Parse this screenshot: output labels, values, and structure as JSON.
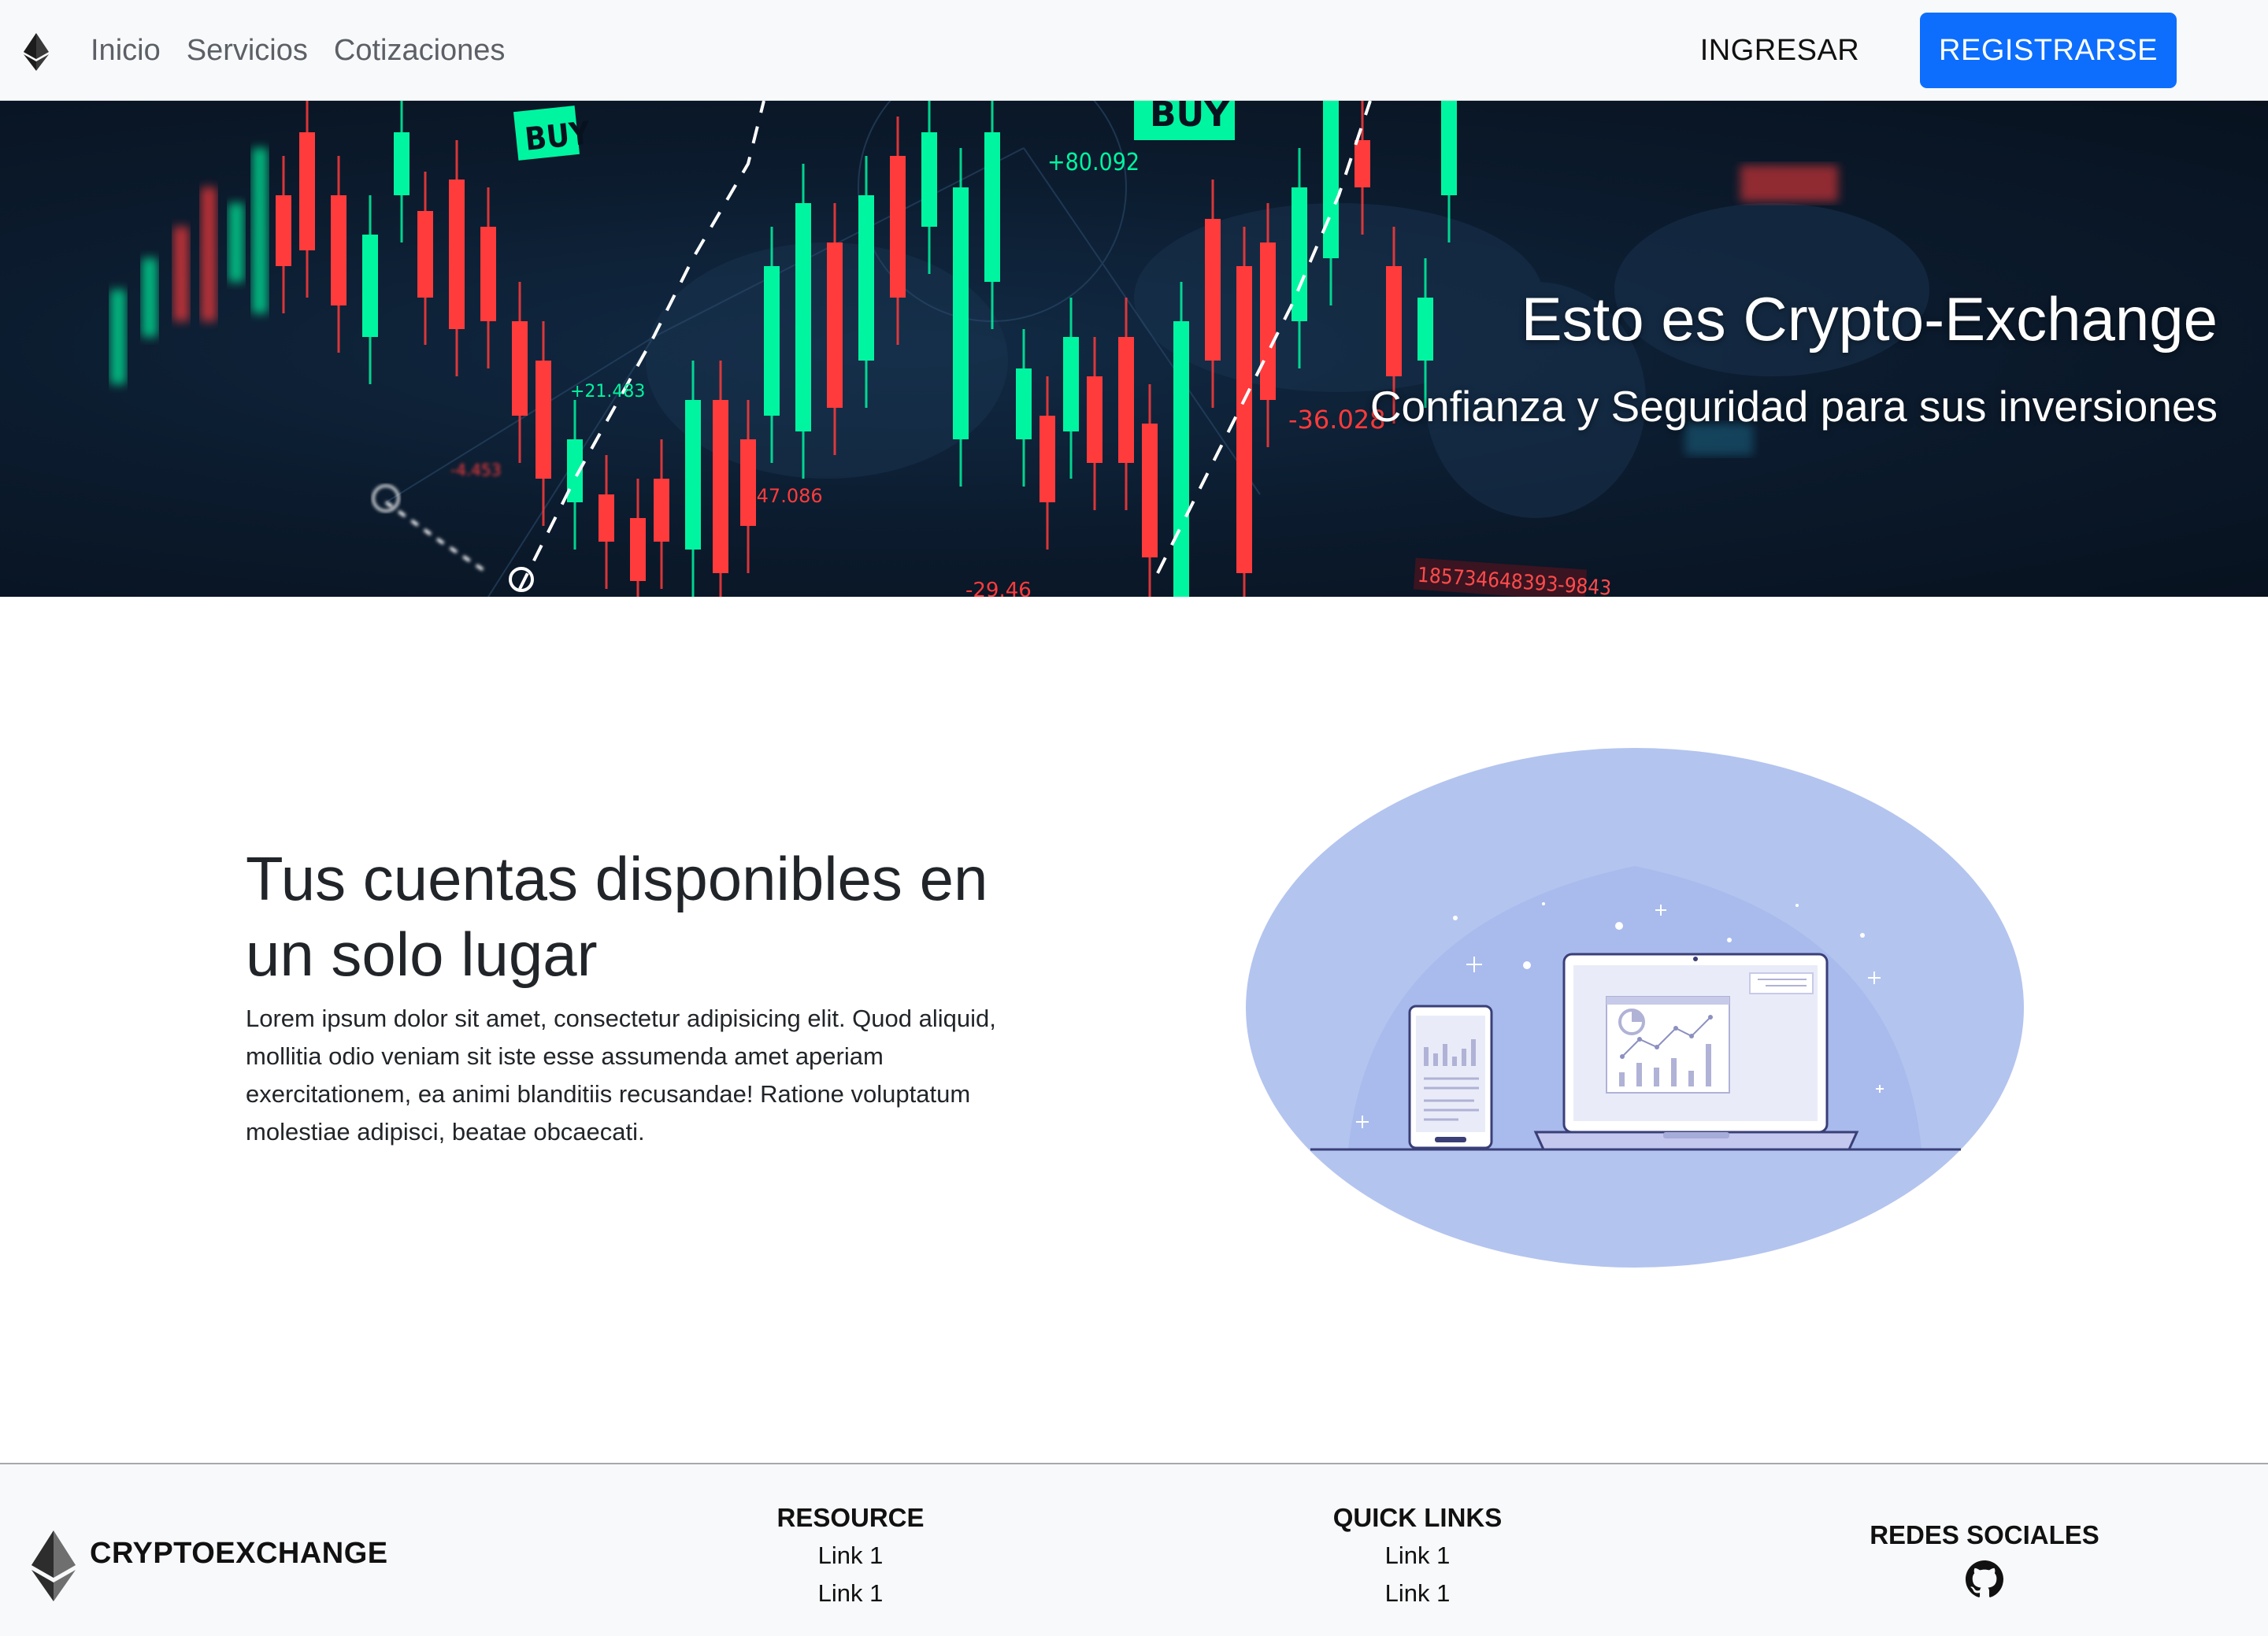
{
  "nav": {
    "logo_icon": "ethereum-icon",
    "links": [
      "Inicio",
      "Servicios",
      "Cotizaciones"
    ],
    "login_label": "INGRESAR",
    "register_label": "REGISTRARSE",
    "accent": "#0d6efd"
  },
  "hero": {
    "title": "Esto es Crypto-Exchange",
    "subtitle": "Confianza y Seguridad para sus inversiones",
    "bg_labels": {
      "buy1": "BUY",
      "buy2": "BUY",
      "n1": "+80.092",
      "n2": "+21.483",
      "n3": "-47.086",
      "n4": "-36.028",
      "n5": "-4.453",
      "n6": "-29.46",
      "n7": "185734648393-9843"
    },
    "colors": {
      "up": "#00f5a0",
      "down": "#ff3b3b"
    }
  },
  "feature": {
    "heading": "Tus cuentas disponibles en un solo lugar",
    "text": "Lorem ipsum dolor sit amet, consectetur adipisicing elit. Quod aliquid, mollitia odio veniam sit iste esse assumenda amet aperiam exercitationem, ea animi blanditiis recusandae! Ratione voluptatum molestiae adipisci, beatae obcaecati.",
    "illustration": "devices-analytics-illustration"
  },
  "footer": {
    "brand": "CRYPTOEXCHANGE",
    "logo_icon": "ethereum-icon",
    "resource": {
      "title": "RESOURCE",
      "links": [
        "Link 1",
        "Link 1"
      ]
    },
    "quick_links": {
      "title": "QUICK LINKS",
      "links": [
        "Link 1",
        "Link 1"
      ]
    },
    "social": {
      "title": "REDES SOCIALES",
      "icon": "github-icon"
    }
  }
}
